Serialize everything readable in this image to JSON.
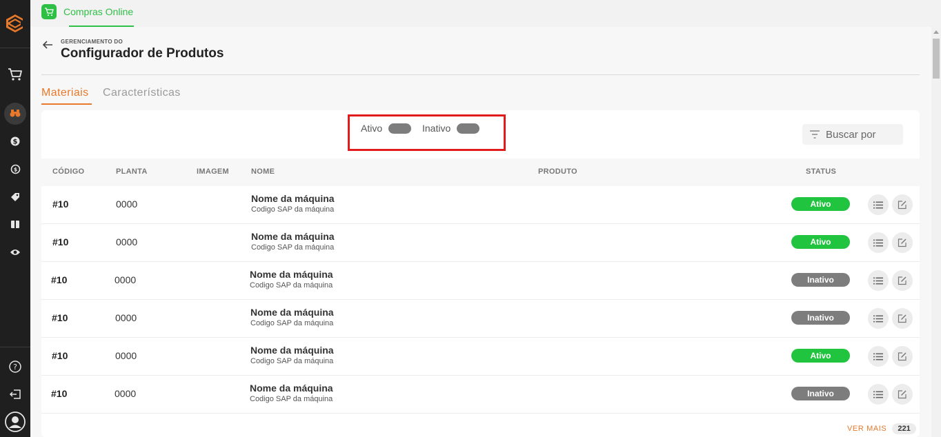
{
  "app": {
    "name": "Compras Online",
    "accent": "#2ebf45"
  },
  "sidebar": {
    "items": [
      {
        "icon": "cart-icon"
      },
      {
        "icon": "binoculars-icon",
        "active": true
      },
      {
        "icon": "dollar-icon"
      },
      {
        "icon": "exchange-icon"
      },
      {
        "icon": "tag-icon"
      },
      {
        "icon": "ticket-icon"
      },
      {
        "icon": "eye-icon"
      }
    ],
    "bottom": [
      {
        "icon": "help-icon"
      },
      {
        "icon": "logout-icon"
      },
      {
        "icon": "user-avatar-icon"
      }
    ]
  },
  "header": {
    "kicker": "GERENCIAMENTO DO",
    "title": "Configurador de Produtos"
  },
  "tabs": [
    {
      "label": "Materiais",
      "active": true
    },
    {
      "label": "Características",
      "active": false
    }
  ],
  "filters": {
    "active_label": "Ativo",
    "inactive_label": "Inativo"
  },
  "search": {
    "placeholder": "Buscar por"
  },
  "table": {
    "columns": [
      "CÓDIGO",
      "PLANTA",
      "IMAGEM",
      "NOME",
      "PRODUTO",
      "STATUS"
    ],
    "rows": [
      {
        "code": "#10",
        "plant": "0000",
        "name": "Nome da máquina",
        "sap": "Codigo SAP da máquina",
        "status": "Ativo"
      },
      {
        "code": "#10",
        "plant": "0000",
        "name": "Nome da máquina",
        "sap": "Codigo SAP da máquina",
        "status": "Ativo"
      },
      {
        "code": "#10",
        "plant": "0000",
        "name": "Nome da máquina",
        "sap": "Codigo SAP da máquina",
        "status": "Inativo"
      },
      {
        "code": "#10",
        "plant": "0000",
        "name": "Nome da máquina",
        "sap": "Codigo SAP da máquina",
        "status": "Inativo"
      },
      {
        "code": "#10",
        "plant": "0000",
        "name": "Nome da máquina",
        "sap": "Codigo SAP da máquina",
        "status": "Ativo"
      },
      {
        "code": "#10",
        "plant": "0000",
        "name": "Nome da máquina",
        "sap": "Codigo SAP da máquina",
        "status": "Inativo"
      }
    ]
  },
  "footer": {
    "more_label": "VER MAIS",
    "count": "221"
  },
  "colors": {
    "orange": "#e8782a",
    "status_active": "#21c43f",
    "status_inactive": "#7d7d7d",
    "highlight": "#e11b1b"
  }
}
